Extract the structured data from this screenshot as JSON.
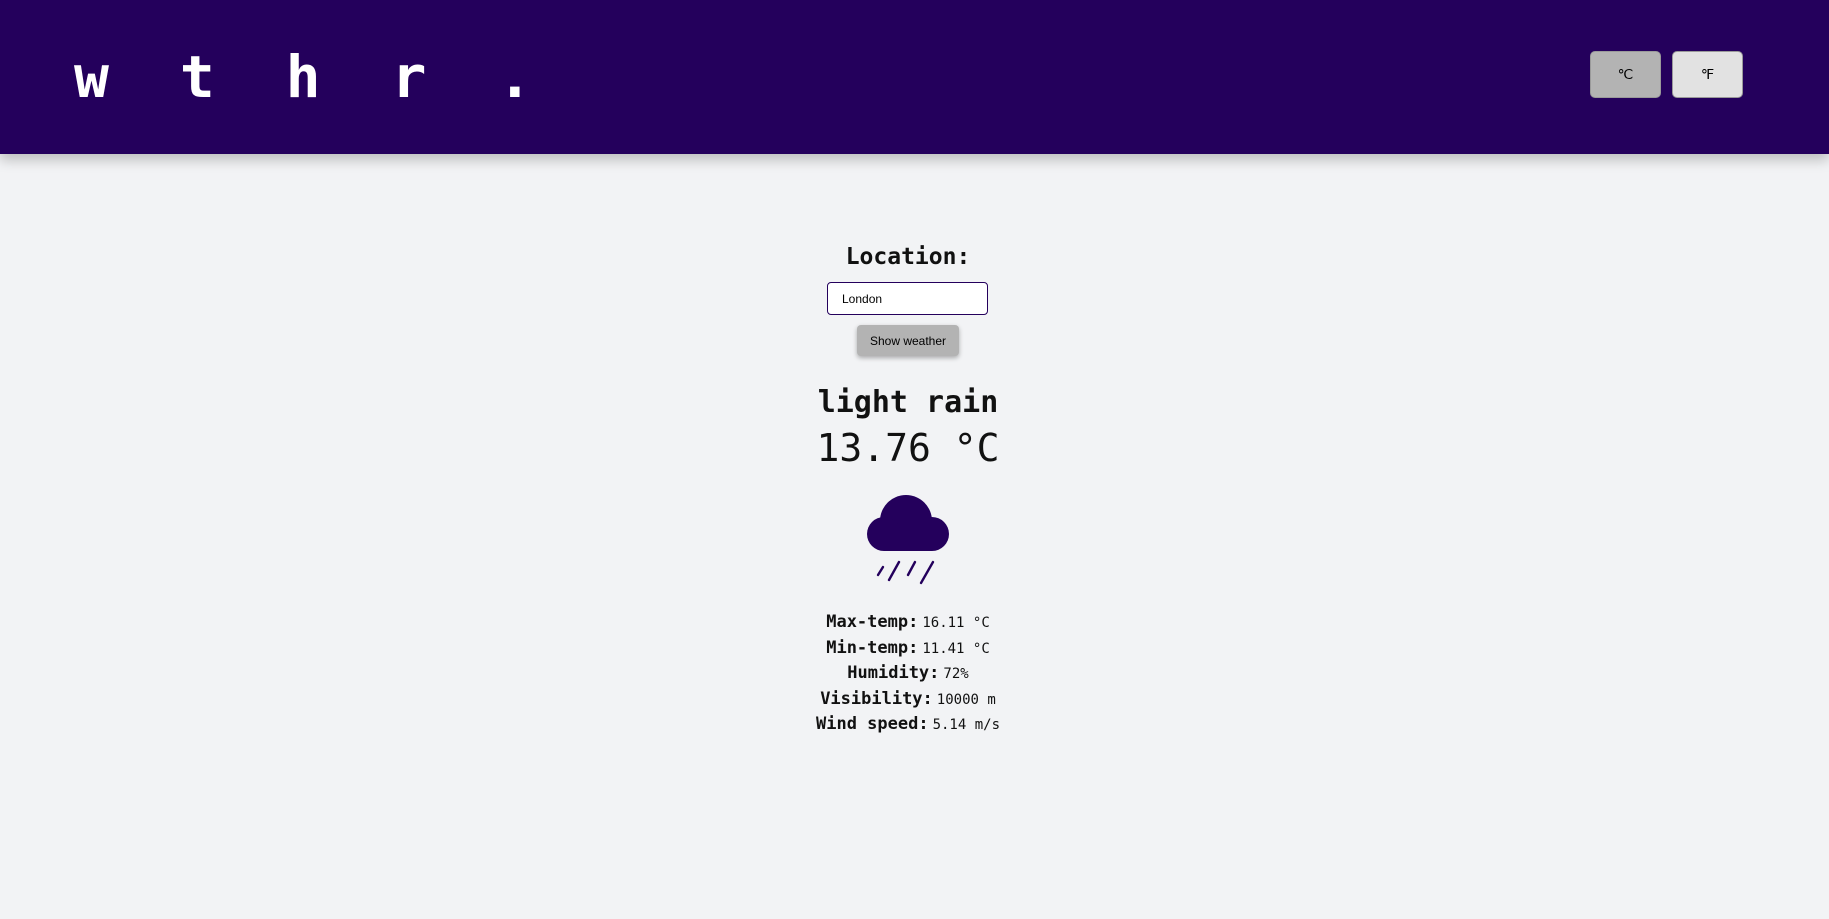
{
  "header": {
    "logo": "w t h r .",
    "units": [
      {
        "label": "℃",
        "active": true
      },
      {
        "label": "℉",
        "active": false
      }
    ]
  },
  "search": {
    "label": "Location:",
    "value": "London",
    "button_label": "Show weather"
  },
  "weather": {
    "description": "light rain",
    "temperature": "13.76 °C",
    "icon": "light-rain-icon",
    "stats": [
      {
        "label": "Max-temp:",
        "value": "16.11 °C"
      },
      {
        "label": "Min-temp:",
        "value": "11.41 °C"
      },
      {
        "label": "Humidity:",
        "value": "72%"
      },
      {
        "label": "Visibility:",
        "value": "10000 m"
      },
      {
        "label": "Wind speed:",
        "value": "5.14 m/s"
      }
    ]
  },
  "colors": {
    "brand": "#24005c",
    "background": "#f2f3f5",
    "button_active": "#b3b3b3",
    "button_inactive": "#e2e2e2"
  }
}
